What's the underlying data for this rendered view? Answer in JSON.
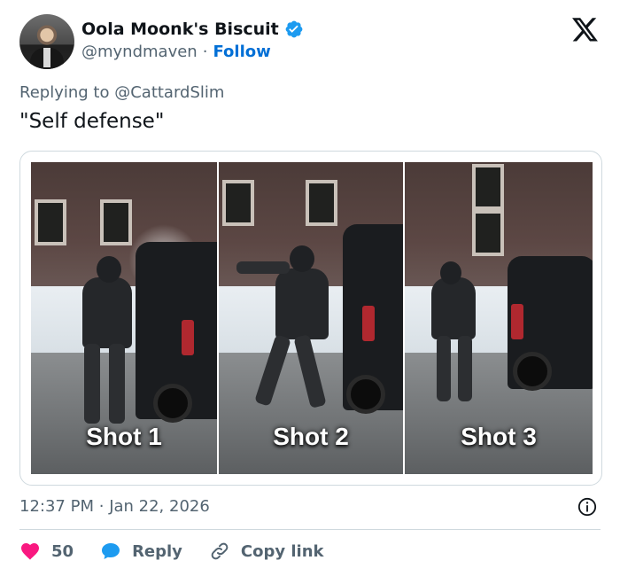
{
  "author": {
    "name": "Oola Moonk's Biscuit",
    "handle": "@myndmaven",
    "separator": "·",
    "follow_label": "Follow",
    "verified": true
  },
  "reply_context": {
    "prefix": "Replying to",
    "handle": "@CattardSlim"
  },
  "tweet": {
    "text": "\"Self defense\""
  },
  "media": {
    "panels": [
      {
        "label": "Shot 1"
      },
      {
        "label": "Shot 2"
      },
      {
        "label": "Shot 3"
      }
    ]
  },
  "meta": {
    "time": "12:37 PM",
    "separator": "·",
    "date": "Jan 22, 2026"
  },
  "actions": {
    "likes": "50",
    "reply_label": "Reply",
    "copy_label": "Copy link"
  },
  "colors": {
    "like": "#f91880",
    "reply": "#1d9bf0",
    "follow": "#006fd6",
    "verified": "#1d9bf0",
    "muted_text": "#536471"
  },
  "icons": {
    "platform": "x-logo-icon",
    "verified": "verified-badge-icon",
    "info": "info-icon",
    "like": "heart-icon",
    "reply": "speech-bubble-icon",
    "copy": "link-icon"
  }
}
